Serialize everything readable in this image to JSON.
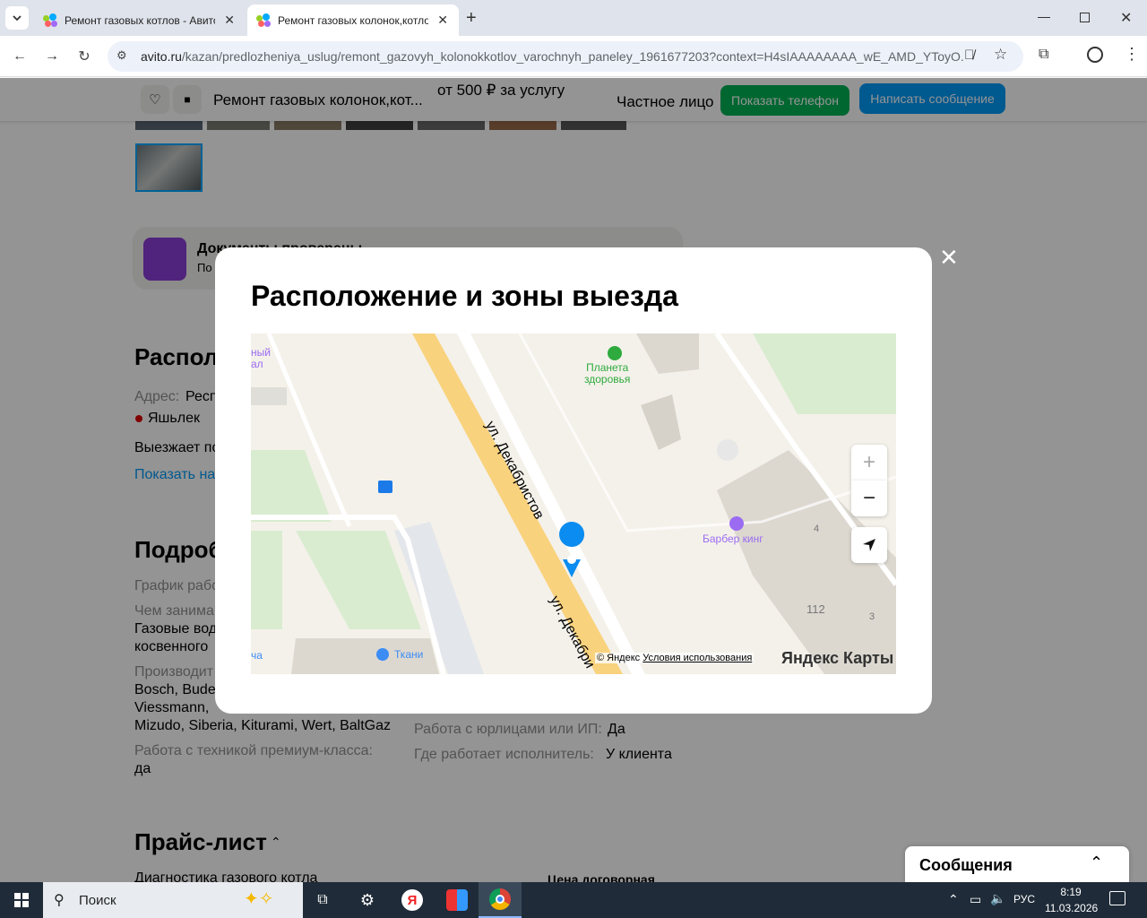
{
  "browser": {
    "tabs": [
      {
        "title": "Ремонт газовых котлов - Авито",
        "active": false
      },
      {
        "title": "Ремонт газовых колонок,котлов",
        "active": true
      }
    ],
    "new_tab": "+",
    "url_host": "avito.ru",
    "url_path": "/kazan/predlozheniya_uslug/remont_gazovyh_kolonokkotlov_varochnyh_paneley_1961677203?context=H4sIAAAAAAAA_wE_AMD_YToyO...",
    "window_controls": [
      "minimize",
      "restore",
      "close"
    ]
  },
  "sticky": {
    "title": "Ремонт газовых колонок,кот...",
    "price": "от 500 ₽ за услугу",
    "seller_type": "Частное лицо",
    "show_phone": "Показать телефон",
    "write_message": "Написать сообщение"
  },
  "background": {
    "docs_title": "Документы проверены",
    "docs_sub": "По о",
    "location_heading": "Располо",
    "address_label": "Адрес:",
    "address_value": "Респ",
    "metro": "Яшьлек",
    "travels": "Выезжает по",
    "show_map": "Показать на",
    "details_heading": "Подроб",
    "schedule_label": "График рабо",
    "what_label": "Чем занима",
    "what_value": "Газовые вод",
    "what_value2": "косвенного",
    "maker_label": "Производит",
    "maker_value1": "Bosch, Bude",
    "maker_value2": "Viessmann,",
    "maker_value3": "Mizudo, Siberia, Kiturami, Wert, BaltGaz",
    "premium_label": "Работа с техникой премиум-класса:",
    "premium_value": "да",
    "legal_label": "Работа с юрлицами или ИП:",
    "legal_value": "Да",
    "where_label": "Где работает исполнитель:",
    "where_value": "У клиента",
    "pricelist_heading": "Прайс-лист",
    "diag_item": "Диагностика газового котла",
    "diag_price": "Цена договорная"
  },
  "modal": {
    "title": "Расположение и зоны выезда",
    "map": {
      "street_1": "ул. Декабристов",
      "street_2": "ул. Декабри",
      "poi_health": "Планета\nздоровья",
      "poi_barber": "Барбер кинг",
      "poi_fabric": "Ткани",
      "poi_left_top": "ный\nал",
      "poi_left_bottom": "ча",
      "house_number": "112",
      "entrance_4": "4",
      "entrance_3": "3",
      "copyright": "© Яндекс",
      "terms": "Условия использования",
      "brand": "Яндекс Карты"
    }
  },
  "messages": {
    "label": "Сообщения"
  },
  "taskbar": {
    "search": "Поиск",
    "lang": "РУС",
    "time": "8:19",
    "date": "11.03.2026"
  },
  "colors": {
    "green": "#02b155",
    "blue": "#0099f7",
    "road": "#f9d27d",
    "pin": "#0a8cf0"
  }
}
